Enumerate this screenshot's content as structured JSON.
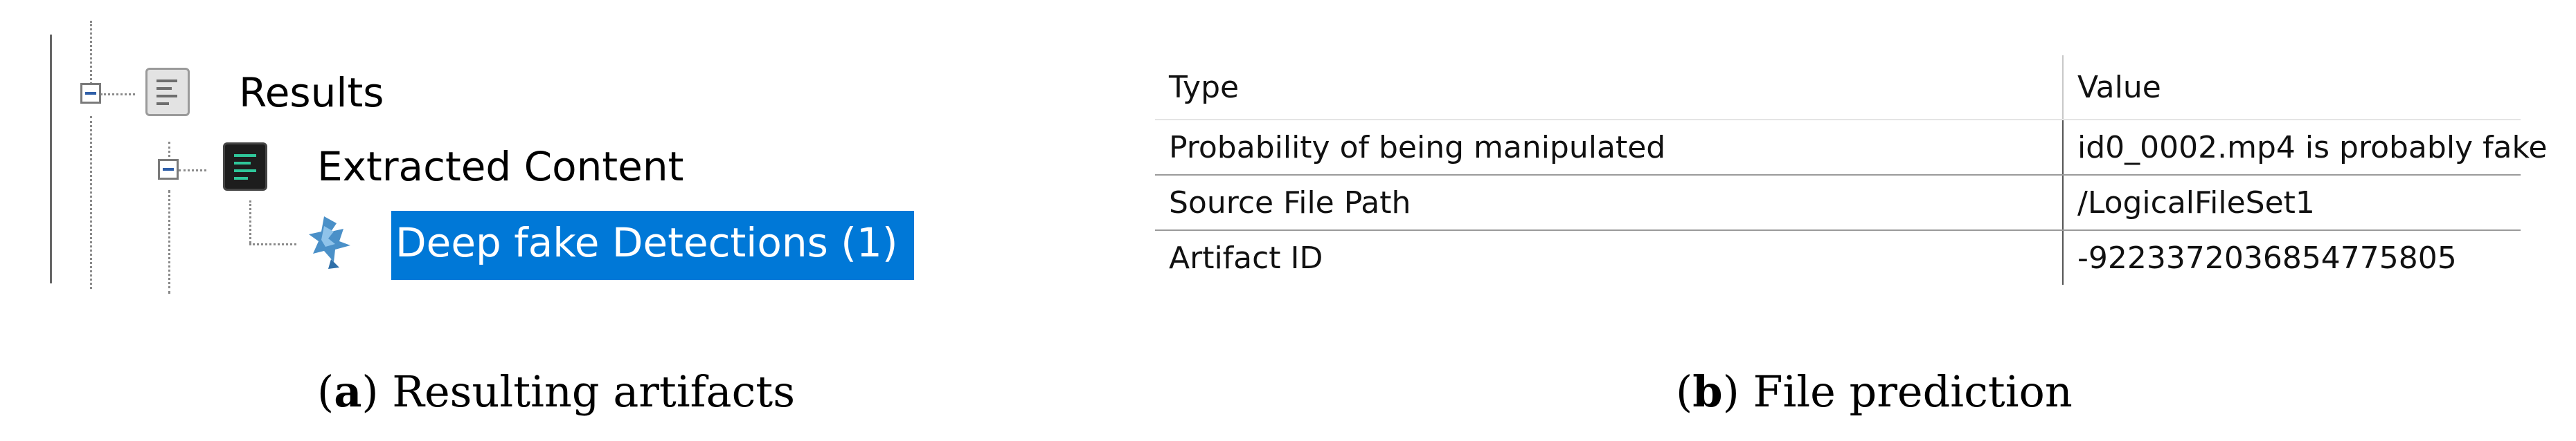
{
  "tree": {
    "items": [
      {
        "label": "Results",
        "expanded": true,
        "icon": "results-icon"
      },
      {
        "label": "Extracted Content",
        "expanded": true,
        "icon": "extracted-content-icon"
      },
      {
        "label": "Deep fake Detections (1)",
        "selected": true,
        "icon": "deep-fake-detection-icon"
      }
    ]
  },
  "table": {
    "columns": [
      "Type",
      "Value"
    ],
    "rows": [
      [
        "Probability of being manipulated",
        "id0_0002.mp4 is probably fake"
      ],
      [
        "Source File Path",
        "/LogicalFileSet1"
      ],
      [
        "Artifact ID",
        "-9223372036854775805"
      ]
    ]
  },
  "captions": {
    "a": {
      "letter": "a",
      "text": " Resulting artifacts"
    },
    "b": {
      "letter": "b",
      "text": " File prediction"
    }
  },
  "colors": {
    "selection": "#0078d7",
    "expander_minus": "#2f5fa8",
    "extracted_icon_accent": "#2fc79a"
  }
}
